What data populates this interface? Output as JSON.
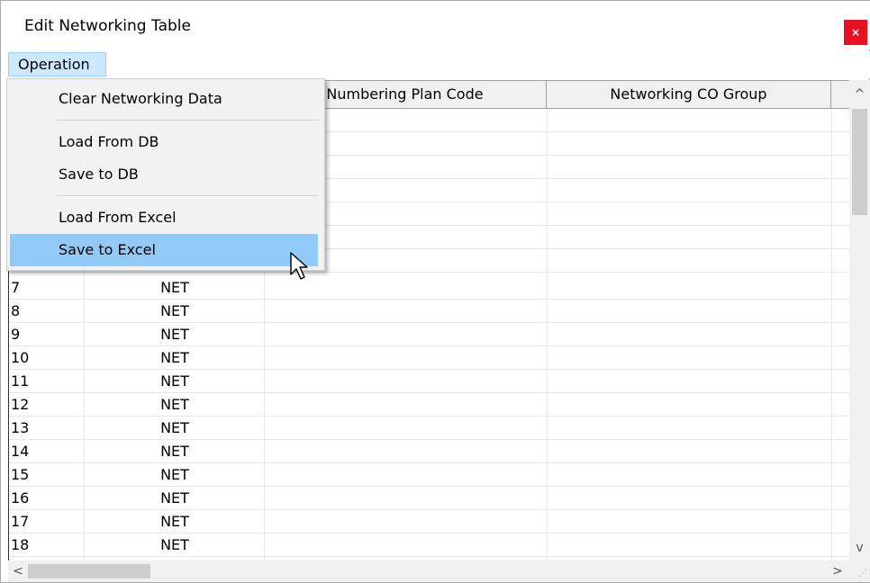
{
  "window": {
    "title": "Edit Networking Table",
    "close_glyph": "×"
  },
  "menubar": {
    "operation": "Operation"
  },
  "menu": {
    "items": [
      {
        "label": "Clear Networking Data"
      },
      {
        "label": "Load From DB"
      },
      {
        "label": "Save to DB"
      },
      {
        "label": "Load From Excel"
      },
      {
        "label": "Save to Excel",
        "highlighted": true
      }
    ]
  },
  "table": {
    "columns": [
      "Numbering Plan Code",
      "Networking CO Group"
    ],
    "rows": [
      {
        "index": "7",
        "type": "NET"
      },
      {
        "index": "8",
        "type": "NET"
      },
      {
        "index": "9",
        "type": "NET"
      },
      {
        "index": "10",
        "type": "NET"
      },
      {
        "index": "11",
        "type": "NET"
      },
      {
        "index": "12",
        "type": "NET"
      },
      {
        "index": "13",
        "type": "NET"
      },
      {
        "index": "14",
        "type": "NET"
      },
      {
        "index": "15",
        "type": "NET"
      },
      {
        "index": "16",
        "type": "NET"
      },
      {
        "index": "17",
        "type": "NET"
      },
      {
        "index": "18",
        "type": "NET"
      }
    ]
  },
  "scrollbars": {
    "up": "^",
    "down": "v",
    "left": "<",
    "right": ">"
  },
  "colors": {
    "close": "#e81123",
    "menu_active": "#cce8ff",
    "item_highlight": "#91c9f7"
  }
}
